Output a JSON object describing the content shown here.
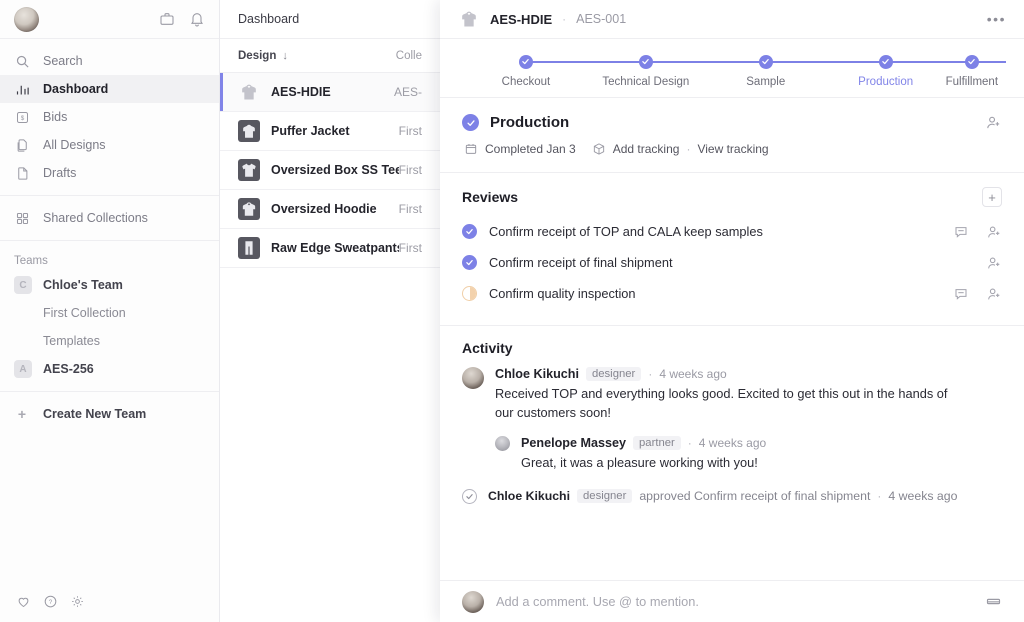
{
  "colors": {
    "accent": "#7d81e6",
    "accent_text": "#8184e8",
    "pending": "#f3d2ad",
    "panel_bg": "#ffffff",
    "sidebar_bg": "#fdfdfd",
    "selected_row_bg": "#f1f1f3",
    "border": "#eeeef1"
  },
  "sidebar": {
    "avatar": "user-avatar",
    "header_icons": [
      {
        "name": "briefcase-icon",
        "label": "Bag"
      },
      {
        "name": "bell-icon",
        "label": "Notifications"
      }
    ],
    "nav": [
      {
        "label": "Search",
        "icon": "search-icon",
        "active": false
      },
      {
        "label": "Dashboard",
        "icon": "chart-bar-icon",
        "active": true
      },
      {
        "label": "Bids",
        "icon": "dollar-icon",
        "active": false
      },
      {
        "label": "All Designs",
        "icon": "copy-icon",
        "active": false
      },
      {
        "label": "Drafts",
        "icon": "document-icon",
        "active": false
      }
    ],
    "shared": {
      "label": "Shared Collections",
      "icon": "grid-icon"
    },
    "teams_label": "Teams",
    "teams": [
      {
        "label": "Chloe's Team",
        "chip": "C",
        "type": "team"
      },
      {
        "label": "First Collection",
        "type": "sub"
      },
      {
        "label": "Templates",
        "type": "sub"
      },
      {
        "label": "AES-256",
        "chip": "A",
        "type": "team"
      }
    ],
    "create_team": "Create New Team",
    "footer_icons": [
      {
        "name": "heart-icon"
      },
      {
        "name": "help-circle-icon"
      },
      {
        "name": "gear-icon"
      }
    ]
  },
  "list": {
    "header": "Dashboard",
    "columns": {
      "design": "Design",
      "sort": "↓",
      "collection": "Colle"
    },
    "rows": [
      {
        "name": "AES-HDIE",
        "collection": "AES-",
        "thumb": "hoodie-thumb-light",
        "selected": true
      },
      {
        "name": "Puffer Jacket",
        "collection": "First",
        "thumb": "puffer-thumb",
        "selected": false
      },
      {
        "name": "Oversized Box SS Tee",
        "collection": "First",
        "thumb": "tee-thumb",
        "selected": false
      },
      {
        "name": "Oversized Hoodie",
        "collection": "First",
        "thumb": "hoodie-thumb",
        "selected": false
      },
      {
        "name": "Raw Edge Sweatpants",
        "collection": "First",
        "thumb": "pants-thumb",
        "selected": false
      }
    ]
  },
  "detail": {
    "title": "AES-HDIE",
    "separator": "·",
    "subtitle": "AES-001",
    "menu": "•••",
    "steps": [
      {
        "label": "Checkout",
        "complete": true,
        "current": false
      },
      {
        "label": "Technical Design",
        "complete": true,
        "current": false
      },
      {
        "label": "Sample",
        "complete": true,
        "current": false
      },
      {
        "label": "Production",
        "complete": true,
        "current": true
      },
      {
        "label": "Fulfillment",
        "complete": true,
        "current": false
      }
    ],
    "production": {
      "title": "Production",
      "completed": "Completed Jan 3",
      "tracking_add": "Add tracking",
      "tracking_mid": "·",
      "tracking_view": "View tracking",
      "add_person": "add-person-icon"
    },
    "reviews": {
      "title": "Reviews",
      "add_label": "+",
      "items": [
        {
          "text": "Confirm receipt of TOP and CALA keep samples",
          "state": "approved",
          "has_comment": true,
          "has_assign": true
        },
        {
          "text": "Confirm receipt of final shipment",
          "state": "approved",
          "has_comment": false,
          "has_assign": true
        },
        {
          "text": "Confirm quality inspection",
          "state": "pending",
          "has_comment": true,
          "has_assign": true
        }
      ]
    },
    "activity": {
      "title": "Activity",
      "posts": [
        {
          "author": "Chloe Kikuchi",
          "role": "designer",
          "dot": "·",
          "time": "4 weeks ago",
          "body": "Received TOP and everything looks good. Excited to get this out in the hands of our customers soon!",
          "reply": false
        },
        {
          "author": "Penelope Massey",
          "role": "partner",
          "dot": "·",
          "time": "4 weeks ago",
          "body": "Great, it was a pleasure working with you!",
          "reply": true
        }
      ],
      "approval": {
        "author": "Chloe Kikuchi",
        "role": "designer",
        "action": "approved Confirm receipt of final shipment",
        "dot": "·",
        "time": "4 weeks ago"
      }
    },
    "comment_bar": {
      "placeholder": "Add a comment. Use @ to mention.",
      "attachment_icon": "attachment-icon"
    }
  }
}
